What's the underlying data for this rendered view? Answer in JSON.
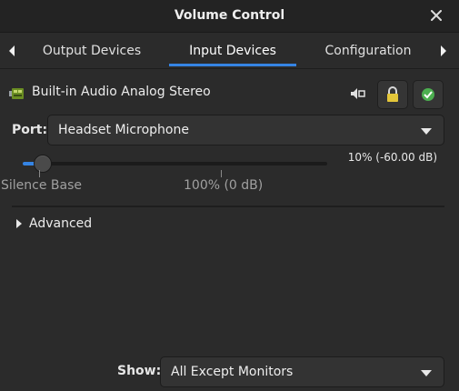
{
  "window": {
    "title": "Volume Control"
  },
  "tabs": [
    {
      "label": "Output Devices",
      "active": false
    },
    {
      "label": "Input Devices",
      "active": true
    },
    {
      "label": "Configuration",
      "active": false
    }
  ],
  "device": {
    "name": "Built-in Audio Analog Stereo",
    "icon": "sound-card-icon",
    "mute_icon": "mute-microphone-icon",
    "lock_icon": "lock-icon",
    "default_icon": "check-default-icon"
  },
  "port": {
    "label": "Port:",
    "value": "Headset Microphone"
  },
  "volume": {
    "readout": "10% (-60.00 dB)",
    "level_percent": 10,
    "ticks": [
      "Silence Base",
      "100% (0 dB)"
    ]
  },
  "advanced": {
    "label": "Advanced",
    "expanded": false
  },
  "show": {
    "label": "Show:",
    "value": "All Except Monitors"
  },
  "colors": {
    "accent": "#3584e4",
    "background": "#2b2b2b",
    "titlebar": "#232323"
  }
}
